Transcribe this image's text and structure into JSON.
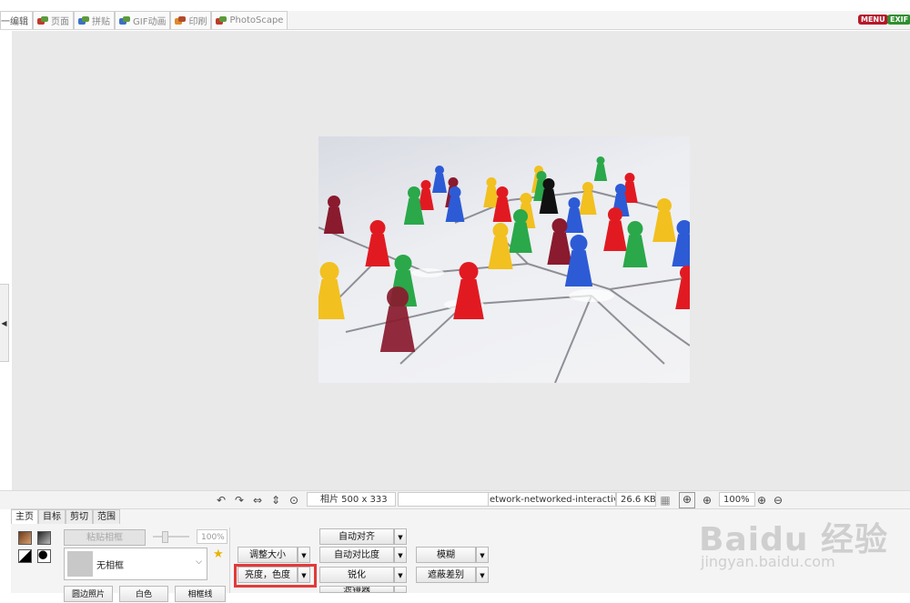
{
  "top_tabs": [
    {
      "label": "一编辑",
      "icon": "edit-icon",
      "active": true
    },
    {
      "label": "页面",
      "icon": "page-icon"
    },
    {
      "label": "拼贴",
      "icon": "combine-icon"
    },
    {
      "label": "GIF动画",
      "icon": "gif-icon"
    },
    {
      "label": "印刷",
      "icon": "print-icon"
    },
    {
      "label": "PhotoScape",
      "icon": "photoscape-icon"
    }
  ],
  "menu_badge": "MENU",
  "exif_badge": "EXIF",
  "status": {
    "photo_size": "相片 500 x 333",
    "empty_field": "",
    "filename": "etwork-networked-interactive-",
    "filesize": "26.6 KB",
    "zoom": "100%"
  },
  "panel": {
    "tabs": [
      "主页",
      "目标",
      "剪切",
      "范围"
    ],
    "paste_frame": "粘贴相框",
    "opacity_value": "100%",
    "frame_select": "无相框",
    "resize": "调整大小",
    "brightness_color": "亮度，色度",
    "auto_level": "自动对齐",
    "auto_contrast": "自动对比度",
    "sharpen": "锐化",
    "filter": "滤镜器",
    "blur": "模糊",
    "mask_diff": "遮蔽差别",
    "bottom_left_1": "圆边照片",
    "bottom_left_2": "白色",
    "bottom_left_3": "相框线"
  },
  "watermark": {
    "main": "Baidu 经验",
    "sub": "jingyan.baidu.com"
  }
}
